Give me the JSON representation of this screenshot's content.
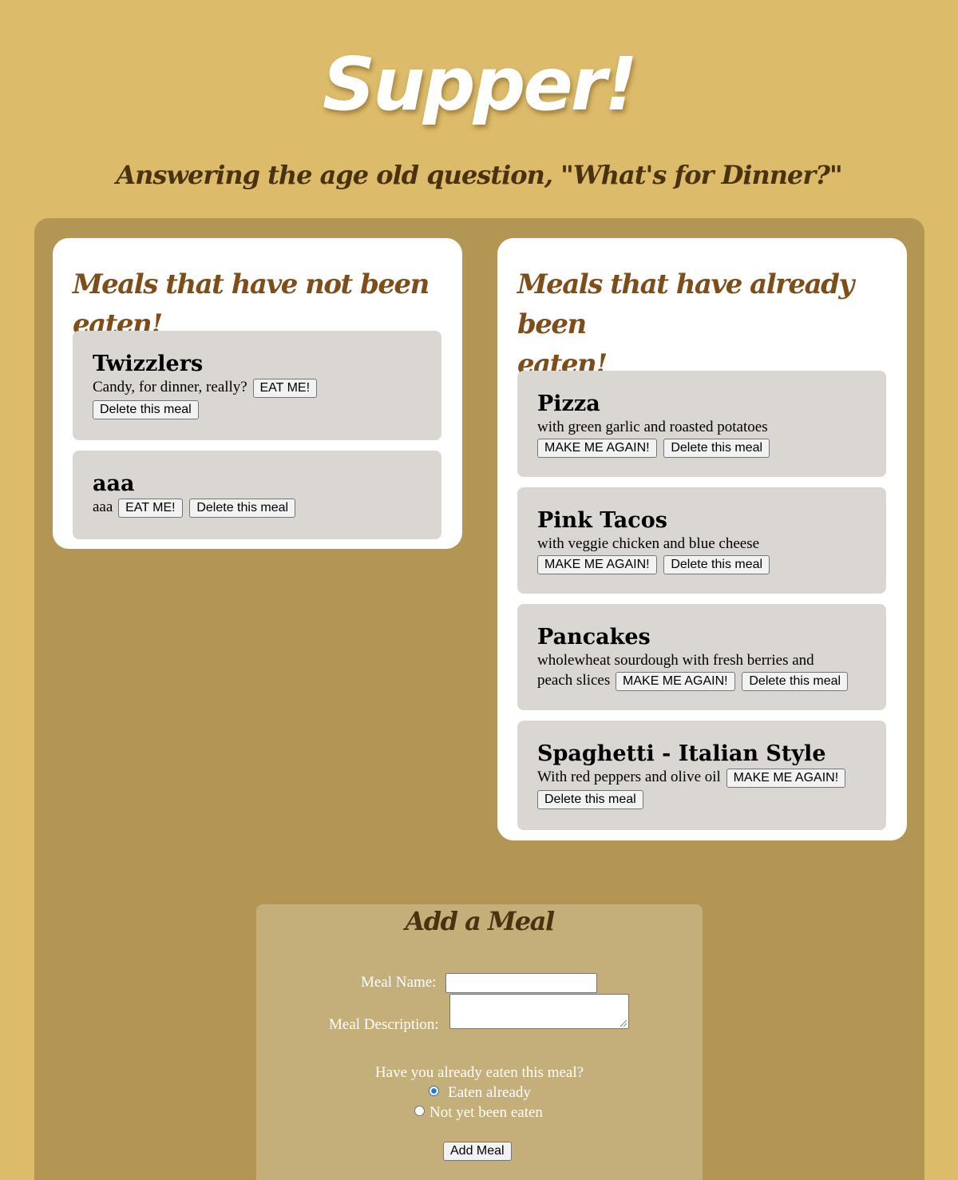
{
  "site": {
    "title": "Supper!",
    "tagline": "Answering the age old question, \"What's for Dinner?\""
  },
  "not_eaten": {
    "heading": "Meals that have not been eaten!",
    "eat_label": "EAT ME!",
    "delete_label": "Delete this meal",
    "meals": [
      {
        "name": "Twizzlers",
        "description": "Candy, for dinner, really?"
      },
      {
        "name": "aaa",
        "description": "aaa"
      }
    ]
  },
  "eaten": {
    "heading_line1": "Meals that have already been",
    "heading_line2": "eaten!",
    "again_label": "MAKE ME AGAIN!",
    "delete_label": "Delete this meal",
    "meals": [
      {
        "name": "Pizza",
        "description": "with green garlic and roasted potatoes"
      },
      {
        "name": "Pink Tacos",
        "description": "with veggie chicken and blue cheese"
      },
      {
        "name": "Pancakes",
        "description_line1": "wholewheat sourdough with fresh berries and",
        "description_line2": "peach slices"
      },
      {
        "name": "Spaghetti - Italian Style",
        "description": "With red peppers and olive oil"
      }
    ]
  },
  "add_form": {
    "heading": "Add a Meal",
    "name_label": "Meal Name:",
    "name_value": "",
    "description_label": "Meal Description:",
    "description_value": "",
    "eaten_question": "Have you already eaten this meal?",
    "option_eaten": "Eaten already",
    "option_not_eaten": "Not yet been eaten",
    "selected_option": "Eaten already",
    "submit_label": "Add Meal"
  },
  "colors": {
    "background": "#dcbb6a",
    "panel": "#b39654",
    "meal_card": "#dad6d1",
    "heading_brown": "#7d4e1a",
    "dark_brown": "#4a3210",
    "form_panel": "#c4af7b"
  }
}
